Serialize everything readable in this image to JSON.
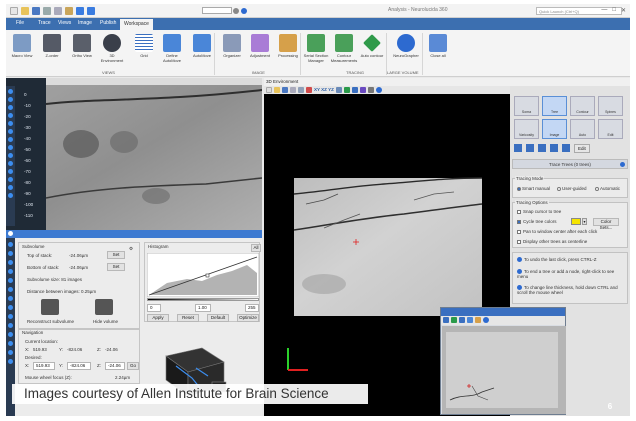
{
  "window": {
    "title": "Neurolucida 360",
    "doc_label": "Analysis - Neurolucida 360",
    "quick_launch_placeholder": "Quick Launch (Ctrl+Q)",
    "help_icon": "help-icon"
  },
  "tabs": [
    "File",
    "Trace",
    "Views",
    "Image",
    "Publish",
    "Workspace"
  ],
  "ribbon": {
    "views": [
      "Macro View",
      "Z-order",
      "Ortho View",
      "3D Environment",
      "Grid",
      "Define AutoMove",
      "AutoMove"
    ],
    "image": [
      "Organizer",
      "Adjustment",
      "Processing"
    ],
    "tracing": [
      "Serial Section Manager",
      "Contour Measurements",
      "Auto contour"
    ],
    "large_volume": [
      "NeuroGrapher"
    ],
    "misc": [
      "Close all"
    ],
    "groups": [
      "VIEWS",
      "IMAGE",
      "TRACING",
      "LARGE VOLUME"
    ]
  },
  "ruler": {
    "ticks": [
      "0",
      "-10",
      "-20",
      "-30",
      "-40",
      "-50",
      "-60",
      "-70",
      "-80",
      "-90",
      "-100",
      "-110"
    ]
  },
  "subvolume": {
    "title": "Subvolume",
    "top_label": "Top of stack:",
    "top_value": "-24.06µm",
    "bottom_label": "Bottom of stack:",
    "bottom_value": "-24.06µm",
    "set_label": "Set",
    "size_label": "Subvolume size: 81 images",
    "distance_label": "Distance between images: 0.25µm",
    "reconstruct_label": "Reconstruct subvolume",
    "hide_label": "Hide volume"
  },
  "histogram": {
    "title": "Histogram",
    "all_label": "All",
    "min": "0",
    "gamma": "1.00",
    "max": "255",
    "apply": "Apply",
    "reset": "Reset",
    "default": "Default",
    "optimize": "Optimize"
  },
  "navigation": {
    "title": "Navigation",
    "current_label": "Current location:",
    "current_x": "519.93",
    "current_y": "-824.06",
    "current_z": "-24.06",
    "desired_label": "Desired:",
    "desired_x": "519.93",
    "desired_y": "-824.06",
    "desired_z": "-24.06",
    "go_label": "Go",
    "focus_label": "Mouse wheel focus (Z):",
    "focus_value": "2.24µm"
  },
  "env": {
    "title": "3D Environment",
    "axes": "XY XZ YZ"
  },
  "trace": {
    "modes": [
      "Soma",
      "Tree",
      "Contour",
      "Spines",
      "Varicosity",
      "Image",
      "Auto",
      "Edit",
      "Proximal",
      "Distal"
    ],
    "edit_label": "Edit",
    "header": "Trace Trees (0 trees)",
    "tracing_mode_title": "Tracing Mode",
    "mode_options": [
      "Smart manual",
      "User-guided",
      "Automatic"
    ],
    "tracing_options_title": "Tracing Options",
    "opt_snap": "Snap cursor to tree",
    "opt_cycle": "Cycle tree colors",
    "opt_pan": "Pan to window center after each click",
    "opt_display": "Display other trees as centerline",
    "color_label": "Color Sets...",
    "tips": [
      "To undo the last click, press CTRL-Z",
      "To end a tree or add a node, right-click to see menu",
      "To change line thickness, hold down CTRL and scroll the mouse wheel"
    ]
  },
  "caption": "Images courtesy of Allen Institute for Brain Science",
  "badge": "6",
  "colors": {
    "accent": "#3c6fb0",
    "tree_color": "#f5e400"
  }
}
